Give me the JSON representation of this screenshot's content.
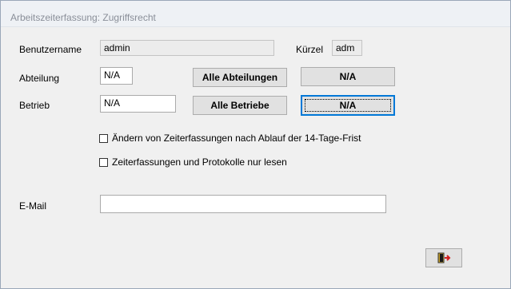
{
  "window": {
    "title": "Arbeitszeiterfassung: Zugriffsrecht"
  },
  "form": {
    "benutzername": {
      "label": "Benutzername",
      "value": "admin"
    },
    "kuerzel": {
      "label": "Kürzel",
      "value": "adm"
    },
    "abteilung": {
      "label": "Abteilung",
      "value": "N/A",
      "all_button": "Alle Abteilungen",
      "select_button": "N/A"
    },
    "betrieb": {
      "label": "Betrieb",
      "value": "N/A",
      "all_button": "Alle Betriebe",
      "select_button": "N/A"
    },
    "checkbox_aendern": {
      "label": "Ändern von Zeiterfassungen nach Ablauf der 14-Tage-Frist",
      "checked": false
    },
    "checkbox_nurlesen": {
      "label": "Zeiterfassungen und Protokolle nur lesen",
      "checked": false
    },
    "email": {
      "label": "E-Mail",
      "value": ""
    }
  },
  "icons": {
    "exit": "exit-door-icon"
  }
}
